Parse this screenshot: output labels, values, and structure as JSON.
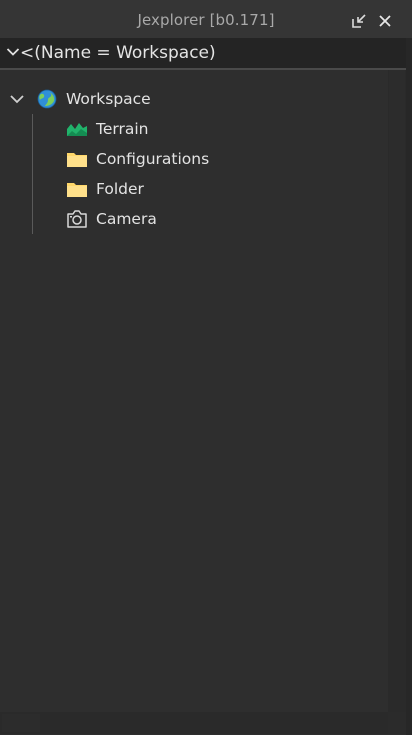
{
  "window": {
    "title": "Jexplorer [b0.171]",
    "buttons": [
      "dock-icon",
      "close-icon"
    ]
  },
  "filter": {
    "query": "<(Name = Workspace)",
    "expander_icon": "chevron-down-icon"
  },
  "tree": {
    "root": {
      "label": "Workspace",
      "icon": "globe-icon",
      "expanded": true
    },
    "children": [
      {
        "label": "Terrain",
        "icon": "terrain-icon",
        "icon_color": "#21b36b"
      },
      {
        "label": "Configurations",
        "icon": "folder-icon",
        "icon_color": "#ffd769"
      },
      {
        "label": "Folder",
        "icon": "folder-icon",
        "icon_color": "#ffd769"
      },
      {
        "label": "Camera",
        "icon": "camera-icon",
        "icon_color": "#d9d9d9"
      }
    ]
  },
  "colors": {
    "background": "#2e2e2e",
    "titlebar": "#353535",
    "text": "#e3e3e3",
    "title_text": "#a9a9a9"
  }
}
